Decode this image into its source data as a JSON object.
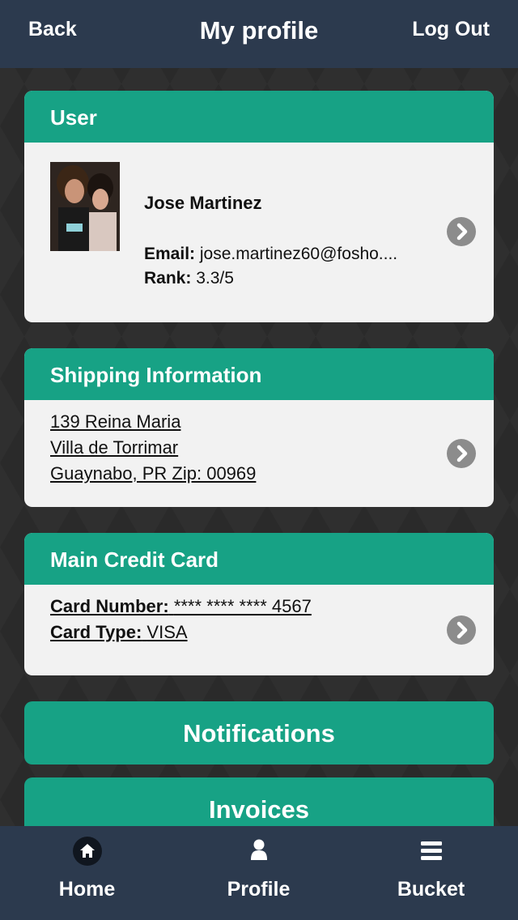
{
  "header": {
    "back_label": "Back",
    "title": "My profile",
    "logout_label": "Log Out"
  },
  "user_card": {
    "heading": "User",
    "name": "Jose Martinez",
    "email_label": "Email:",
    "email_value": "jose.martinez60@fosho....",
    "rank_label": "Rank:",
    "rank_value": "3.3/5"
  },
  "shipping_card": {
    "heading": "Shipping Information",
    "address_lines": [
      "139 Reina Maria",
      "Villa de Torrimar",
      "Guaynabo, PR Zip: 00969"
    ]
  },
  "credit_card": {
    "heading": "Main Credit Card",
    "number_label": "Card Number:",
    "number_value": "**** **** **** 4567",
    "type_label": "Card Type:",
    "type_value": "VISA"
  },
  "buttons": {
    "notifications_label": "Notifications",
    "invoices_label": "Invoices"
  },
  "tabbar": {
    "items": [
      {
        "label": "Home",
        "icon": "home-icon"
      },
      {
        "label": "Profile",
        "icon": "person-icon"
      },
      {
        "label": "Bucket",
        "icon": "menu-lines-icon"
      }
    ]
  },
  "colors": {
    "accent": "#17a285",
    "navbar": "#2c3a4e",
    "card_bg": "#f2f2f2",
    "background": "#2a2a2a"
  }
}
